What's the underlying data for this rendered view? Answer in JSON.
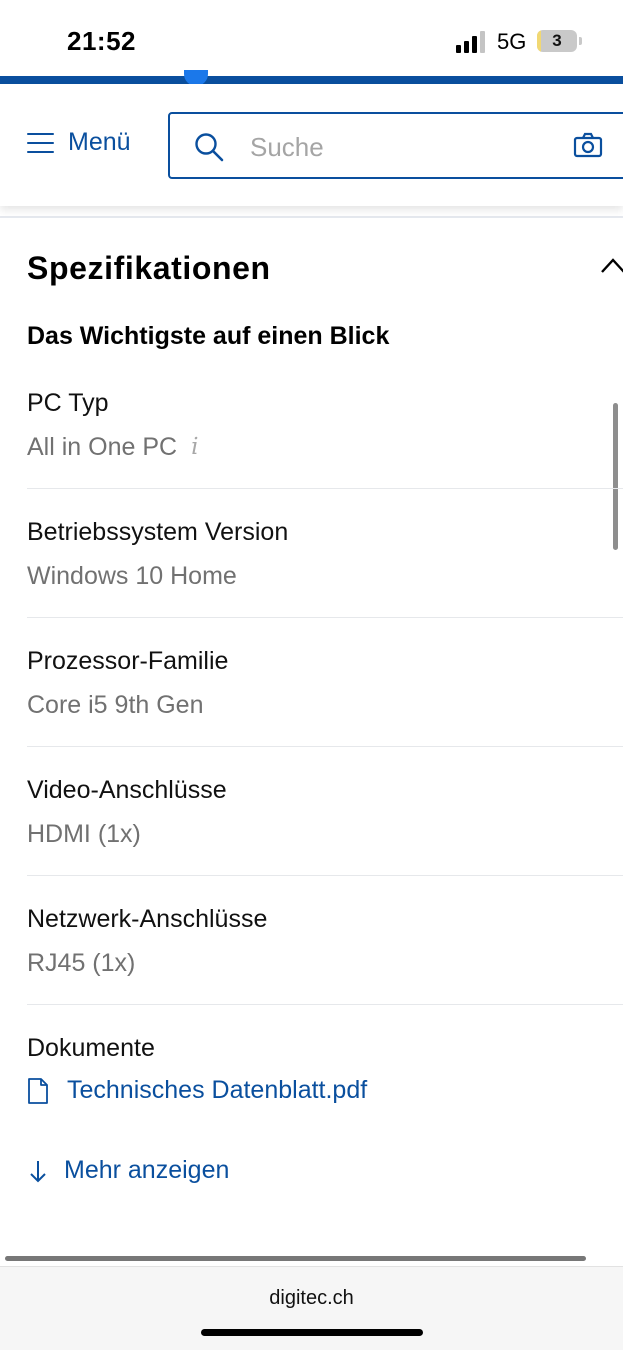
{
  "status_bar": {
    "time": "21:52",
    "network": "5G",
    "battery_level": "3",
    "battery_fraction": 0.1
  },
  "page_progress": {
    "value": 0.32
  },
  "header": {
    "menu_label": "Menü",
    "search_placeholder": "Suche",
    "accent_color": "#0a4f9e"
  },
  "specs": {
    "title": "Spezifikationen",
    "subtitle": "Das Wichtigste auf einen Blick",
    "items": [
      {
        "label": "PC Typ",
        "value": "All in One PC",
        "info_icon": "info-icon"
      },
      {
        "label": "Betriebssystem Version",
        "value": "Windows 10 Home"
      },
      {
        "label": "Prozessor-Familie",
        "value": "Core i5 9th Gen"
      },
      {
        "label": "Video-Anschlüsse",
        "value": "HDMI (1x)"
      },
      {
        "label": "Netzwerk-Anschlüsse",
        "value": "RJ45 (1x)"
      }
    ],
    "documents": {
      "label": "Dokumente",
      "file_name": "Technisches Datenblatt.pdf",
      "icon": "document-icon"
    },
    "more_label": "Mehr anzeigen"
  },
  "browser": {
    "url": "digitec.ch"
  }
}
